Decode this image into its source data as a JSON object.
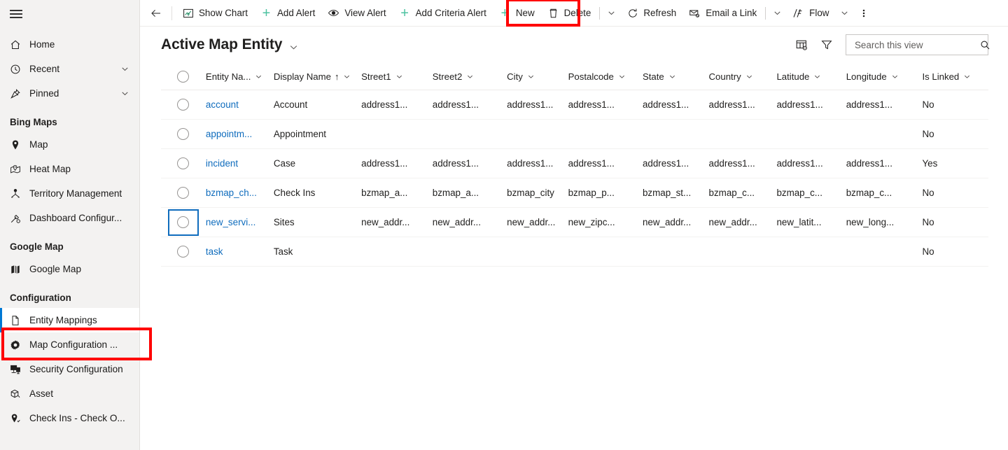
{
  "sidebar": {
    "hamburger_label": "Site Map",
    "top_items": [
      {
        "label": "Home",
        "icon": "home-icon",
        "chevron": false
      },
      {
        "label": "Recent",
        "icon": "clock-icon",
        "chevron": true
      },
      {
        "label": "Pinned",
        "icon": "pin-icon",
        "chevron": true
      }
    ],
    "groups": [
      {
        "title": "Bing Maps",
        "items": [
          {
            "label": "Map",
            "icon": "map-pin-icon"
          },
          {
            "label": "Heat Map",
            "icon": "heat-map-icon"
          },
          {
            "label": "Territory Management",
            "icon": "territory-icon"
          },
          {
            "label": "Dashboard Configur...",
            "icon": "dashboard-config-icon"
          }
        ]
      },
      {
        "title": "Google Map",
        "items": [
          {
            "label": "Google Map",
            "icon": "folded-map-icon"
          }
        ]
      },
      {
        "title": "Configuration",
        "items": [
          {
            "label": "Entity Mappings",
            "icon": "document-icon",
            "selected": true
          },
          {
            "label": "Map Configuration ...",
            "icon": "gear-icon",
            "selected": false
          },
          {
            "label": "Security Configuration",
            "icon": "security-icon",
            "selected": false
          },
          {
            "label": "Asset",
            "icon": "asset-icon",
            "selected": false
          },
          {
            "label": "Check Ins - Check O...",
            "icon": "check-in-pin-icon",
            "selected": false
          }
        ]
      }
    ]
  },
  "commandbar": {
    "back_label": "Back",
    "items": [
      {
        "label": "Show Chart",
        "icon": "chart-icon"
      },
      {
        "label": "Add Alert",
        "icon": "plus-icon"
      },
      {
        "label": "View Alert",
        "icon": "eye-icon"
      },
      {
        "label": "Add Criteria Alert",
        "icon": "plus-icon"
      },
      {
        "label": "New",
        "icon": "plus-icon"
      },
      {
        "label": "Delete",
        "icon": "trash-icon"
      },
      {
        "label": "Refresh",
        "icon": "refresh-icon"
      },
      {
        "label": "Email a Link",
        "icon": "email-link-icon"
      },
      {
        "label": "Flow",
        "icon": "flow-icon"
      }
    ],
    "overflow_label": "More commands"
  },
  "view": {
    "title": "Active Map Entity",
    "title_caret_label": "Change view",
    "edit_columns_label": "Edit columns",
    "edit_filters_label": "Edit filters"
  },
  "search": {
    "placeholder": "Search this view",
    "value": "",
    "button_label": "Search"
  },
  "grid": {
    "select_all_label": "Select all rows",
    "columns": [
      {
        "key": "entity_name",
        "label": "Entity Na...",
        "sorted": false,
        "width": "8.2%"
      },
      {
        "key": "display_name",
        "label": "Display Name",
        "sorted": true,
        "sort_dir": "asc",
        "width": "10.6%"
      },
      {
        "key": "street1",
        "label": "Street1",
        "sorted": false,
        "width": "8.6%"
      },
      {
        "key": "street2",
        "label": "Street2",
        "sorted": false,
        "width": "9.0%"
      },
      {
        "key": "city",
        "label": "City",
        "sorted": false,
        "width": "7.4%"
      },
      {
        "key": "postalcode",
        "label": "Postalcode",
        "sorted": false,
        "width": "9.0%"
      },
      {
        "key": "state",
        "label": "State",
        "sorted": false,
        "width": "8.0%"
      },
      {
        "key": "country",
        "label": "Country",
        "sorted": false,
        "width": "8.2%"
      },
      {
        "key": "latitude",
        "label": "Latitude",
        "sorted": false,
        "width": "8.4%"
      },
      {
        "key": "longitude",
        "label": "Longitude",
        "sorted": false,
        "width": "9.2%"
      },
      {
        "key": "is_linked",
        "label": "Is Linked",
        "sorted": false,
        "width": "8.0%"
      }
    ],
    "rows": [
      {
        "selected": false,
        "focused": false,
        "entity_name": "account",
        "display_name": "Account",
        "street1": "address1...",
        "street2": "address1...",
        "city": "address1...",
        "postalcode": "address1...",
        "state": "address1...",
        "country": "address1...",
        "latitude": "address1...",
        "longitude": "address1...",
        "is_linked": "No"
      },
      {
        "selected": false,
        "focused": false,
        "entity_name": "appointm...",
        "display_name": "Appointment",
        "street1": "",
        "street2": "",
        "city": "",
        "postalcode": "",
        "state": "",
        "country": "",
        "latitude": "",
        "longitude": "",
        "is_linked": "No"
      },
      {
        "selected": false,
        "focused": false,
        "entity_name": "incident",
        "display_name": "Case",
        "street1": "address1...",
        "street2": "address1...",
        "city": "address1...",
        "postalcode": "address1...",
        "state": "address1...",
        "country": "address1...",
        "latitude": "address1...",
        "longitude": "address1...",
        "is_linked": "Yes"
      },
      {
        "selected": false,
        "focused": false,
        "entity_name": "bzmap_ch...",
        "display_name": "Check Ins",
        "street1": "bzmap_a...",
        "street2": "bzmap_a...",
        "city": "bzmap_city",
        "postalcode": "bzmap_p...",
        "state": "bzmap_st...",
        "country": "bzmap_c...",
        "latitude": "bzmap_c...",
        "longitude": "bzmap_c...",
        "is_linked": "No"
      },
      {
        "selected": false,
        "focused": true,
        "entity_name": "new_servi...",
        "display_name": "Sites",
        "street1": "new_addr...",
        "street2": "new_addr...",
        "city": "new_addr...",
        "postalcode": "new_zipc...",
        "state": "new_addr...",
        "country": "new_addr...",
        "latitude": "new_latit...",
        "longitude": "new_long...",
        "is_linked": "No"
      },
      {
        "selected": false,
        "focused": false,
        "entity_name": "task",
        "display_name": "Task",
        "street1": "",
        "street2": "",
        "city": "",
        "postalcode": "",
        "state": "",
        "country": "",
        "latitude": "",
        "longitude": "",
        "is_linked": "No"
      }
    ]
  },
  "annotations": [
    {
      "name": "new-button-highlight",
      "color": "#ff0000"
    },
    {
      "name": "entity-mappings-highlight",
      "color": "#ff0000"
    }
  ],
  "colors": {
    "accent": "#0078d4",
    "link": "#0f6cbd",
    "plus_green": "#4cc2a0",
    "annotation_red": "#ff0000",
    "sidebar_bg": "#f3f2f1"
  }
}
